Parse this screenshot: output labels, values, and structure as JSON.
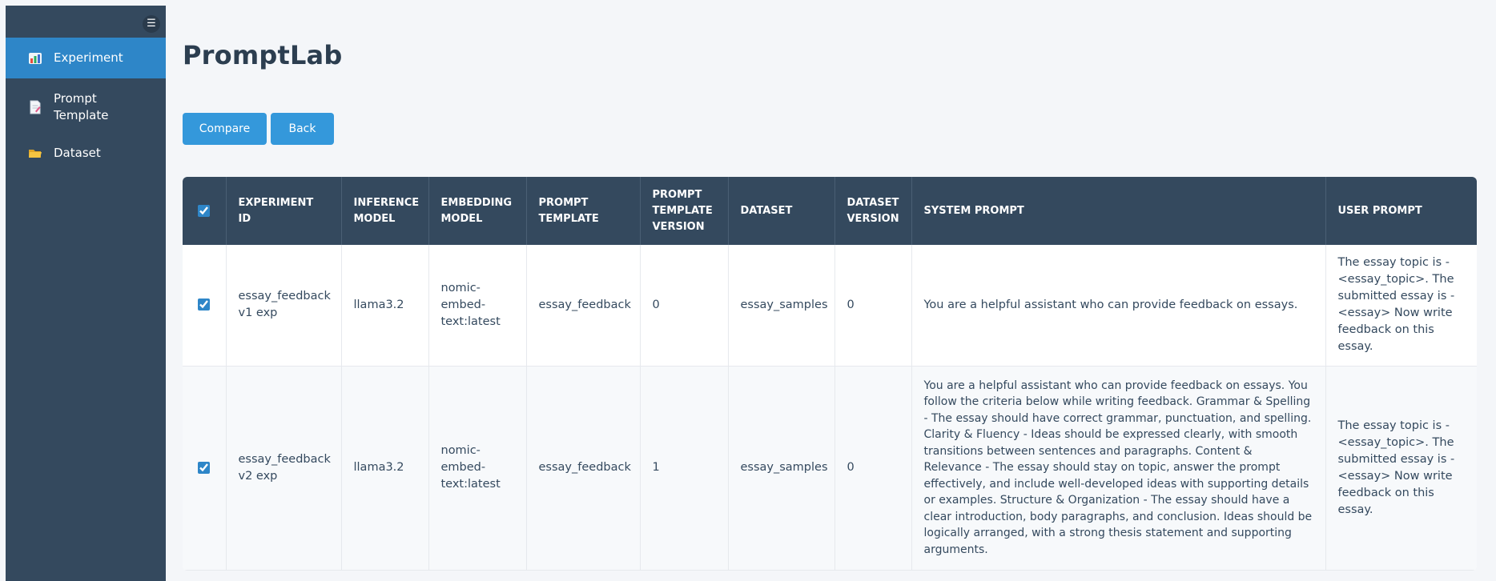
{
  "app": {
    "title": "PromptLab"
  },
  "sidebar": {
    "toggle_icon": "hamburger-icon",
    "items": [
      {
        "label": "Experiment",
        "icon": "chart-icon",
        "active": true
      },
      {
        "label": "Prompt Template",
        "icon": "document-icon",
        "active": false
      },
      {
        "label": "Dataset",
        "icon": "folder-icon",
        "active": false
      }
    ]
  },
  "toolbar": {
    "compare_label": "Compare",
    "back_label": "Back"
  },
  "colors": {
    "sidebar_bg": "#34495e",
    "active_item": "#2e86c8",
    "button": "#3498db",
    "header_bg": "#34495e"
  },
  "table": {
    "headers": [
      "EXPERIMENT ID",
      "INFERENCE MODEL",
      "EMBEDDING MODEL",
      "PROMPT TEMPLATE",
      "PROMPT TEMPLATE VERSION",
      "DATASET",
      "DATASET VERSION",
      "SYSTEM PROMPT",
      "USER PROMPT"
    ],
    "select_all_checked": true,
    "rows": [
      {
        "checked": true,
        "cells": [
          "essay_feedback v1 exp",
          "llama3.2",
          "nomic-embed-text:latest",
          "essay_feedback",
          "0",
          "essay_samples",
          "0",
          "You are a helpful assistant who can provide feedback on essays.",
          "The essay topic is - <essay_topic>. The submitted essay is - <essay> Now write feedback on this essay."
        ]
      },
      {
        "checked": true,
        "cells": [
          "essay_feedback v2 exp",
          "llama3.2",
          "nomic-embed-text:latest",
          "essay_feedback",
          "1",
          "essay_samples",
          "0",
          "You are a helpful assistant who can provide feedback on essays. You follow the criteria below while writing feedback. Grammar & Spelling - The essay should have correct grammar, punctuation, and spelling. Clarity & Fluency - Ideas should be expressed clearly, with smooth transitions between sentences and paragraphs. Content & Relevance - The essay should stay on topic, answer the prompt effectively, and include well-developed ideas with supporting details or examples. Structure & Organization - The essay should have a clear introduction, body paragraphs, and conclusion. Ideas should be logically arranged, with a strong thesis statement and supporting arguments.",
          "The essay topic is - <essay_topic>. The submitted essay is - <essay> Now write feedback on this essay."
        ]
      }
    ]
  }
}
